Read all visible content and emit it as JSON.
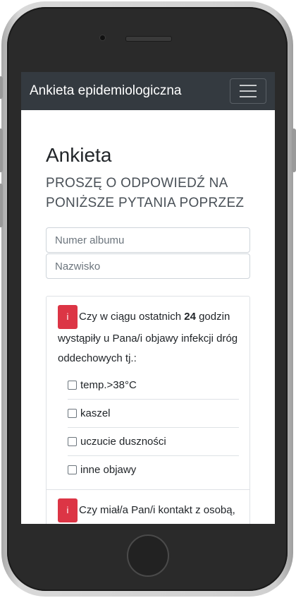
{
  "navbar": {
    "brand": "Ankieta epidemiologiczna",
    "menu_icon": "hamburger-icon"
  },
  "page": {
    "title": "Ankieta",
    "lead_line1": "PROSZĘ O ODPOWIEDŹ NA",
    "lead_line2": "PONIŻSZE PYTANIA POPRZEZ"
  },
  "form": {
    "album_placeholder": "Numer albumu",
    "surname_placeholder": "Nazwisko"
  },
  "questions": [
    {
      "badge": "i",
      "text_prefix": "Czy w ciągu ostatnich ",
      "text_bold": "24",
      "text_suffix": " godzin wystąpiły u Pana/i objawy infekcji dróg oddechowych tj.:",
      "options": [
        "temp.>38°C",
        "kaszel",
        "uczucie duszności",
        "inne objawy"
      ]
    },
    {
      "badge": "i",
      "text": "Czy miał/a Pan/i kontakt z osobą, u której podejrzewano lub"
    }
  ],
  "colors": {
    "navbar": "#343a40",
    "badge": "#dc3545"
  }
}
